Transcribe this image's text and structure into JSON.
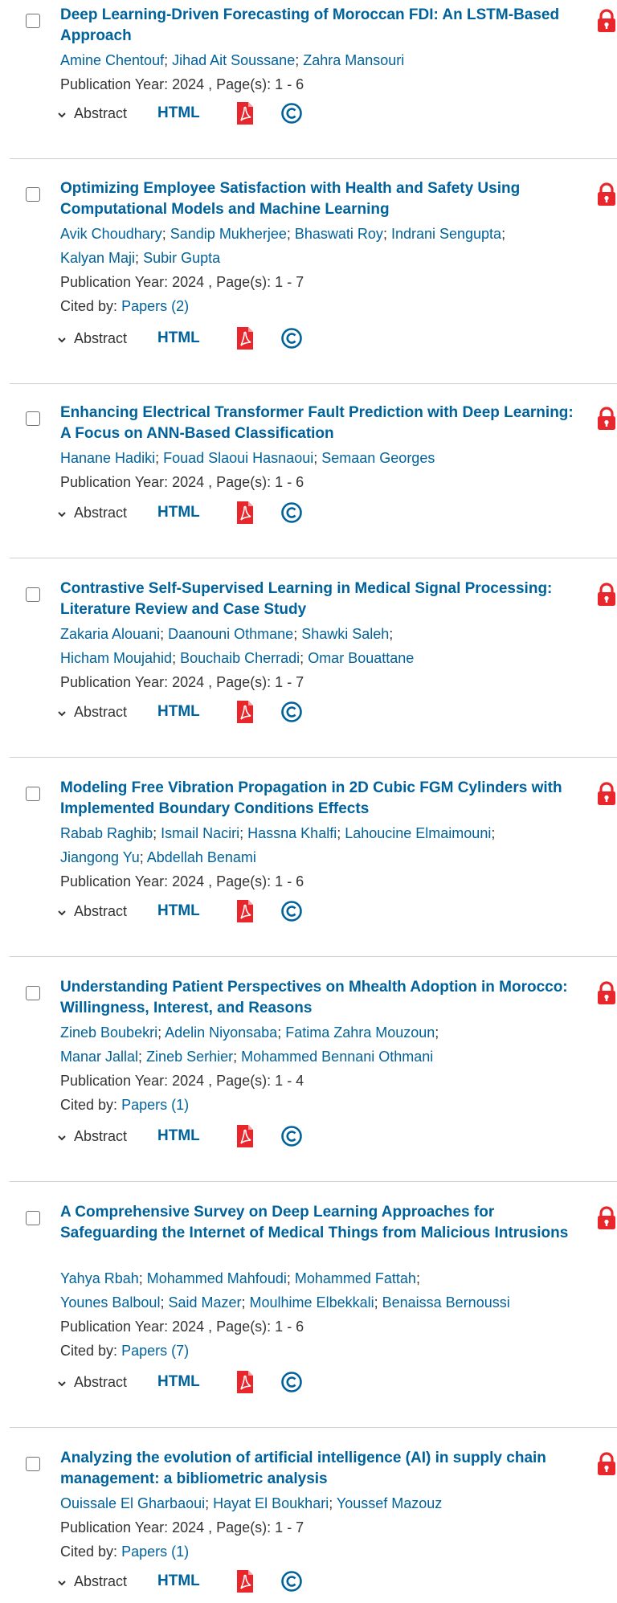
{
  "results": [
    {
      "title": "Deep Learning-Driven Forecasting of Moroccan FDI: An LSTM-Based Approach",
      "author_lines": [
        [
          "Amine Chentouf",
          "Jihad Ait Soussane",
          "Zahra Mansouri"
        ]
      ],
      "publication": "Publication Year: 2024 , Page(s): 1  -  6",
      "cited_label": "",
      "cited_link": ""
    },
    {
      "title": "Optimizing Employee Satisfaction with Health and Safety Using Computational Models and Machine Learning",
      "author_lines": [
        [
          "Avik Choudhary",
          "Sandip Mukherjee",
          "Bhaswati Roy",
          "Indrani Sengupta"
        ],
        [
          "Kalyan Maji",
          "Subir Gupta"
        ]
      ],
      "publication": "Publication Year: 2024 , Page(s): 1  -  7",
      "cited_label": "Cited by:",
      "cited_link": "Papers (2)"
    },
    {
      "title": "Enhancing Electrical Transformer Fault Prediction with Deep Learning: A Focus on ANN-Based Classification",
      "author_lines": [
        [
          "Hanane Hadiki",
          "Fouad Slaoui Hasnaoui",
          "Semaan Georges"
        ]
      ],
      "publication": "Publication Year: 2024 , Page(s): 1  -  6",
      "cited_label": "",
      "cited_link": ""
    },
    {
      "title": "Contrastive Self-Supervised Learning in Medical Signal Processing: Literature Review and Case Study",
      "author_lines": [
        [
          "Zakaria Alouani",
          "Daanouni Othmane",
          "Shawki Saleh"
        ],
        [
          "Hicham Moujahid",
          "Bouchaib Cherradi",
          "Omar Bouattane"
        ]
      ],
      "publication": "Publication Year: 2024 , Page(s): 1  -  7",
      "cited_label": "",
      "cited_link": ""
    },
    {
      "title": "Modeling Free Vibration Propagation in 2D Cubic FGM Cylinders with Implemented Boundary Conditions Effects",
      "author_lines": [
        [
          "Rabab Raghib",
          "Ismail Naciri",
          "Hassna Khalfi",
          "Lahoucine Elmaimouni"
        ],
        [
          "Jiangong Yu",
          "Abdellah Benami"
        ]
      ],
      "publication": "Publication Year: 2024 , Page(s): 1  -  6",
      "cited_label": "",
      "cited_link": ""
    },
    {
      "title": "Understanding Patient Perspectives on Mhealth Adoption in Morocco: Willingness, Interest, and Reasons",
      "author_lines": [
        [
          "Zineb Boubekri",
          "Adelin Niyonsaba",
          "Fatima Zahra Mouzoun"
        ],
        [
          "Manar Jallal",
          "Zineb Serhier",
          "Mohammed Bennani Othmani"
        ]
      ],
      "publication": "Publication Year: 2024 , Page(s): 1  -  4",
      "cited_label": "Cited by:",
      "cited_link": "Papers (1)"
    },
    {
      "title": "A Comprehensive Survey on Deep Learning Approaches for Safeguarding the Internet of Medical Things from Malicious Intrusions",
      "author_lines": [
        [
          "Yahya Rbah",
          "Mohammed Mahfoudi",
          "Mohammed Fattah"
        ],
        [
          "Younes Balboul",
          "Said Mazer",
          "Moulhime Elbekkali",
          "Benaissa Bernoussi"
        ]
      ],
      "publication": "Publication Year: 2024 , Page(s): 1  -  6",
      "cited_label": "Cited by:",
      "cited_link": "Papers (7)"
    },
    {
      "title": "Analyzing the evolution of artificial intelligence (AI) in supply chain management: a bibliometric analysis",
      "author_lines": [
        [
          "Ouissale El Gharbaoui",
          "Hayat El Boukhari",
          "Youssef Mazouz"
        ]
      ],
      "publication": "Publication Year: 2024 , Page(s): 1  -  7",
      "cited_label": "Cited by:",
      "cited_link": "Papers (1)"
    }
  ],
  "actions": {
    "abstract_label": "Abstract",
    "html_label": "HTML"
  },
  "icons": {
    "select": "checkbox-icon",
    "locked": "lock-icon",
    "expand": "chevron-down-icon",
    "pdf": "pdf-icon",
    "rights": "copyright-icon"
  },
  "colors": {
    "link": "#00629b",
    "lock": "#e8262b",
    "pdf": "#e8262b",
    "text": "#333333",
    "divider": "#cfcfcf"
  }
}
